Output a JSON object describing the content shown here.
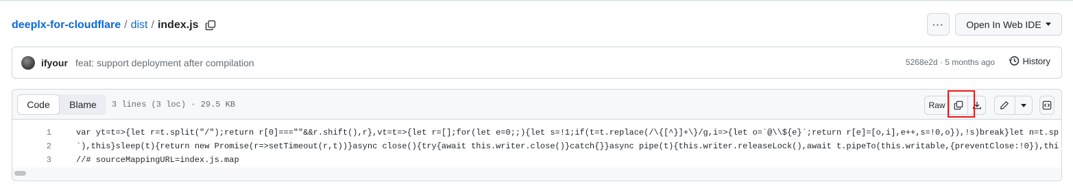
{
  "breadcrumb": {
    "repo": "deeplx-for-cloudflare",
    "separator": "/",
    "folder": "dist",
    "file": "index.js"
  },
  "header": {
    "more_label": "···",
    "web_ide_label": "Open In Web IDE"
  },
  "commit": {
    "author": "ifyour",
    "message": "feat: support deployment after compilation",
    "meta": "5268e2d · 5 months ago",
    "history_label": "History"
  },
  "file": {
    "tabs": {
      "code": "Code",
      "blame": "Blame"
    },
    "info": "3 lines (3 loc) · 29.5 KB",
    "raw_label": "Raw",
    "lines": [
      {
        "n": "1",
        "text": "var yt=t=>{let r=t.split(\"/\");return r[0]===\"\"&&r.shift(),r},vt=t=>{let r=[];for(let e=0;;){let s=!1;if(t=t.replace(/\\{[^}]+\\}/g,i=>{let o=`@\\\\${e}`;return r[e]=[o,i],e++,s=!0,o}),!s)break}let n=t.sp"
      },
      {
        "n": "2",
        "text": "`),this}sleep(t){return new Promise(r=>setTimeout(r,t))}async close(){try{await this.writer.close()}catch{}}async pipe(t){this.writer.releaseLock(),await t.pipeTo(this.writable,{preventClose:!0}),thi"
      },
      {
        "n": "3",
        "text": "//# sourceMappingURL=index.js.map"
      }
    ]
  },
  "colors": {
    "link": "#0969da",
    "highlight_box": "#e01b1b"
  }
}
